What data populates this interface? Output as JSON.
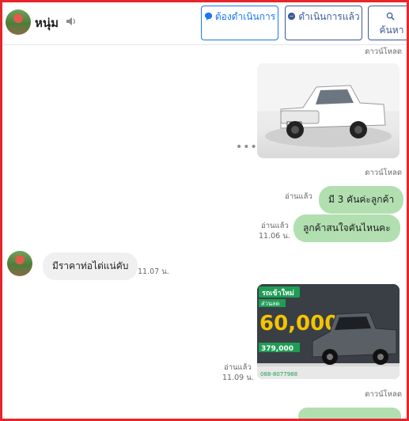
{
  "header": {
    "contact_name": "หนุ่ม",
    "buttons": [
      {
        "label": "ต้องดำเนินการ"
      },
      {
        "label": "ดำเนินการแล้ว"
      },
      {
        "label": "ค้นหา"
      }
    ]
  },
  "download_label": "ดาวน์โหลด",
  "messages": [
    {
      "type": "image-out",
      "caption": "",
      "image": "white pickup truck"
    },
    {
      "type": "text-out",
      "text": "มี 3 คันค่ะลูกค้า",
      "status": "อ่านแล้ว"
    },
    {
      "type": "text-out",
      "text": "ลูกค้าสนใจคันไหนคะ",
      "status": "อ่านแล้ว",
      "time": "11.06 น."
    },
    {
      "type": "text-in",
      "text": "มีราคาท่อไต่แน่คับ",
      "time": "11.07 น."
    },
    {
      "type": "image-out",
      "status": "อ่านแล้ว",
      "time": "11.09 น.",
      "image_text": {
        "headline": "รถเข้าใหม่",
        "sub": "ส่วนลด",
        "amount": "60,000",
        "price": "379,000",
        "phone": "088-8077988"
      }
    }
  ],
  "colors": {
    "accent": "#1877f2",
    "outgoing_bubble": "#b2dfb0",
    "incoming_bubble": "#f0f0f0",
    "frame": "#e5262b"
  }
}
